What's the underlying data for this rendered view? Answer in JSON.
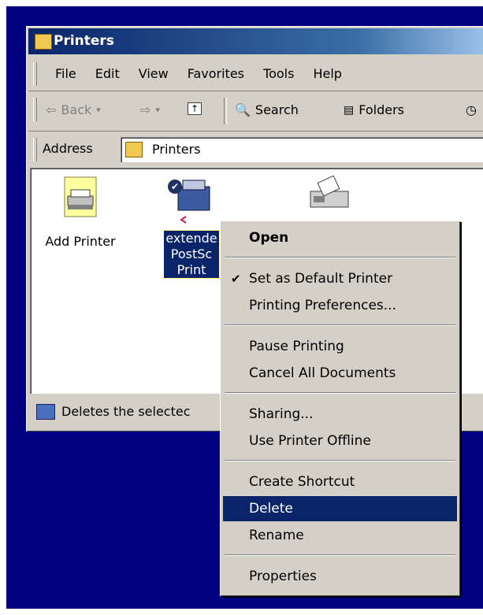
{
  "window": {
    "title": "Printers"
  },
  "menubar": {
    "items": [
      "File",
      "Edit",
      "View",
      "Favorites",
      "Tools",
      "Help"
    ]
  },
  "toolbar": {
    "back_label": "Back",
    "search_label": "Search",
    "folders_label": "Folders"
  },
  "addressbar": {
    "label": "Address",
    "value": "Printers"
  },
  "icons": [
    {
      "label": "Add Printer"
    },
    {
      "label_lines": [
        "extende",
        "PostSc",
        "Print"
      ]
    }
  ],
  "statusbar": {
    "text": "Deletes the selectec"
  },
  "context_menu": {
    "open": "Open",
    "set_default": "Set as Default Printer",
    "printing_prefs": "Printing Preferences...",
    "pause": "Pause Printing",
    "cancel_all": "Cancel All Documents",
    "sharing": "Sharing...",
    "use_offline": "Use Printer Offline",
    "create_shortcut": "Create Shortcut",
    "delete": "Delete",
    "rename": "Rename",
    "properties": "Properties"
  },
  "colors": {
    "desktop": "#000080",
    "highlight": "#0a246a",
    "face": "#d4d0c8"
  }
}
